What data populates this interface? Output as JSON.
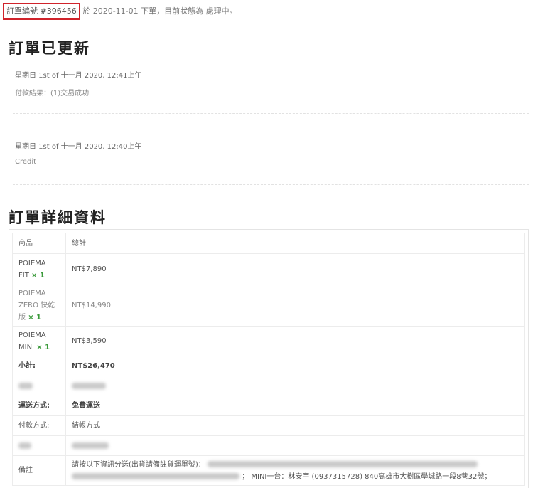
{
  "header": {
    "order_number": "訂單編號 #396456",
    "order_meta": "於 2020-11-01 下單，目前狀態為 處理中。"
  },
  "updates": {
    "title": "訂單已更新",
    "notes": [
      {
        "date": "星期日 1st of 十一月 2020, 12:41上午",
        "text": "付款結果：(1)交易成功"
      },
      {
        "date": "星期日 1st of 十一月 2020, 12:40上午",
        "text": "Credit"
      }
    ]
  },
  "details": {
    "title": "訂單詳細資料",
    "col_product": "商品",
    "col_total": "總計",
    "items": [
      {
        "name_line1": "POIEMA",
        "name_line2": "FIT",
        "name_line3": "",
        "qty": "× 1",
        "total": "NT$7,890"
      },
      {
        "name_line1": "POIEMA",
        "name_line2": "ZERO 快乾",
        "name_line3": "版",
        "qty": "× 1",
        "total": "NT$14,990"
      },
      {
        "name_line1": "POIEMA",
        "name_line2": "MINI",
        "name_line3": "",
        "qty": "× 1",
        "total": "NT$3,590"
      }
    ],
    "subtotal_label": "小計:",
    "subtotal_value": "NT$26,470",
    "shipping_label": "運送方式:",
    "shipping_value": "免費運送",
    "payment_label": "付款方式:",
    "payment_value": "結帳方式",
    "remark_label": "備註",
    "remark_line1": "請按以下資訊分送(出貨請備註貨運單號)：",
    "remark_line2_visible": "； MINI一台：林安宇 (0937315728) 840高雄市大樹區學城路一段8巷32號；"
  }
}
